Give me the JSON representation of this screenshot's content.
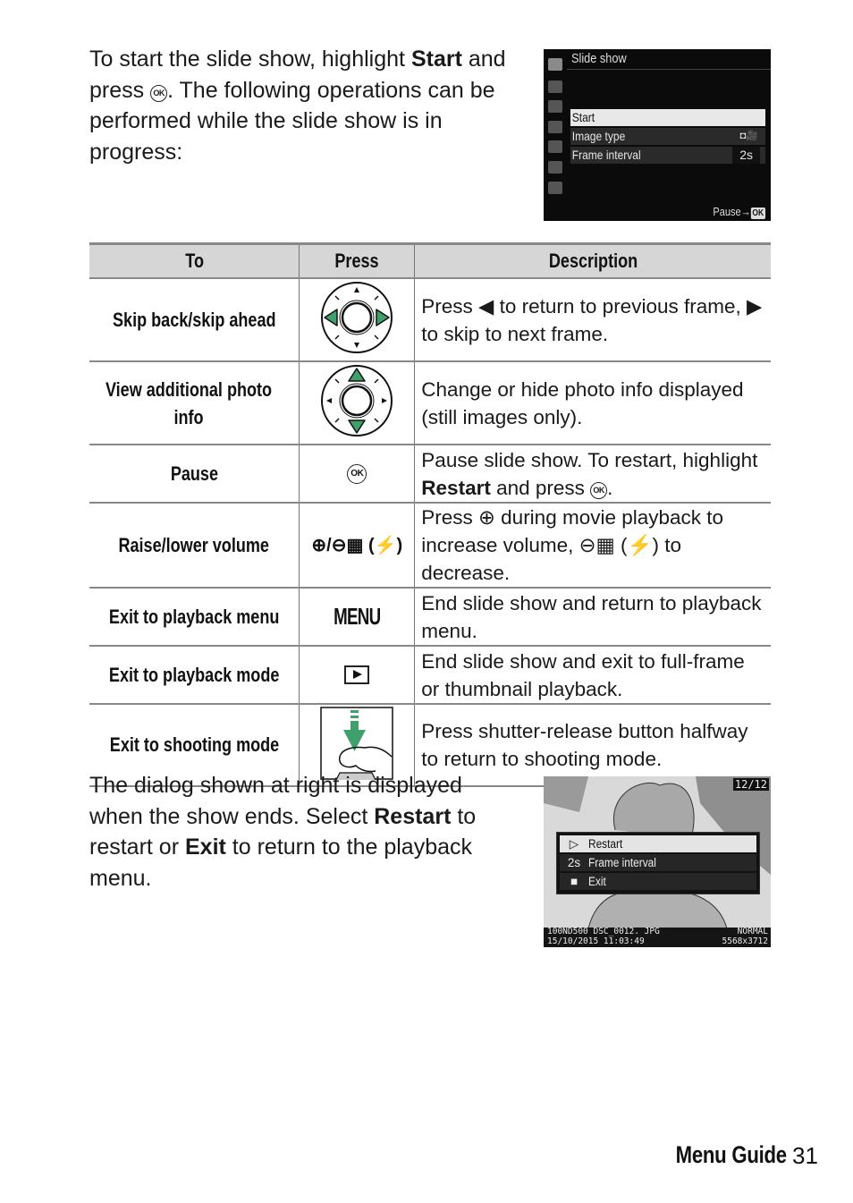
{
  "intro": {
    "text_before": "To start the slide show, highlight ",
    "bold": "Start",
    "text_mid": " and press ",
    "ok_symbol": "OK",
    "text_after": ".  The following operations can be performed while the slide show is in progress:"
  },
  "screen1": {
    "title": "Slide show",
    "sidebar_icons": [
      "playback-icon",
      "camera-icon",
      "movie-icon",
      "pencil-icon",
      "wrench-icon",
      "retouch-icon",
      "recent-settings-icon"
    ],
    "rows": [
      {
        "label": "Start",
        "value": "",
        "highlighted": true
      },
      {
        "label": "Image type",
        "value": "◘🎥"
      },
      {
        "label": "Frame interval",
        "value": "2s"
      }
    ],
    "footer_label": "Pause→",
    "footer_ok": "OK"
  },
  "table": {
    "headers": [
      "To",
      "Press",
      "Description"
    ],
    "rows": [
      {
        "to": "Skip back/skip ahead",
        "press_icon": "multi-selector-left-right-icon",
        "desc": "Press ◀ to return to previous frame, ▶ to skip to next frame."
      },
      {
        "to": "View additional photo info",
        "press_icon": "multi-selector-up-down-icon",
        "desc": "Change or hide photo info displayed (still images only)."
      },
      {
        "to": "Pause",
        "press_icon": "ok-button-icon",
        "press_text": "OK",
        "desc_before": "Pause slide show.  To restart, highlight ",
        "desc_bold": "Restart",
        "desc_after": " and press ",
        "desc_end": "."
      },
      {
        "to": "Raise/lower volume",
        "press_icon": "zoom-in-out-icon",
        "press_text": "⊕/⊖▦ (⚡)",
        "desc": "Press ⊕ during movie playback to increase volume, ⊖▦ (⚡) to decrease."
      },
      {
        "to": "Exit to playback menu",
        "press_icon": "menu-button-icon",
        "press_text": "MENU",
        "desc": "End slide show and return to playback menu."
      },
      {
        "to": "Exit to playback mode",
        "press_icon": "playback-button-icon",
        "desc": "End slide show and exit to full-frame or thumbnail playback."
      },
      {
        "to": "Exit to shooting mode",
        "press_icon": "shutter-release-icon",
        "desc": "Press shutter-release button halfway to return to shooting mode."
      }
    ]
  },
  "outro": {
    "t1": "The dialog shown at right is displayed when the show ends.  Select ",
    "b1": "Restart",
    "t2": " to restart or ",
    "b2": "Exit",
    "t3": " to return to the playback menu."
  },
  "screen2": {
    "counter": "12/12",
    "dialog": [
      {
        "icon": "▷",
        "label": "Restart",
        "highlighted": true
      },
      {
        "icon": "2s",
        "label": "Frame interval"
      },
      {
        "icon": "■",
        "label": "Exit"
      }
    ],
    "info_line1_left": "100ND500  DSC_0012. JPG",
    "info_line2_left": "15/10/2015  11:03:49",
    "info_line1_right": "NORMAL",
    "info_line2_right": "5568x3712"
  },
  "footer": {
    "section": "Menu Guide",
    "page": "31"
  }
}
